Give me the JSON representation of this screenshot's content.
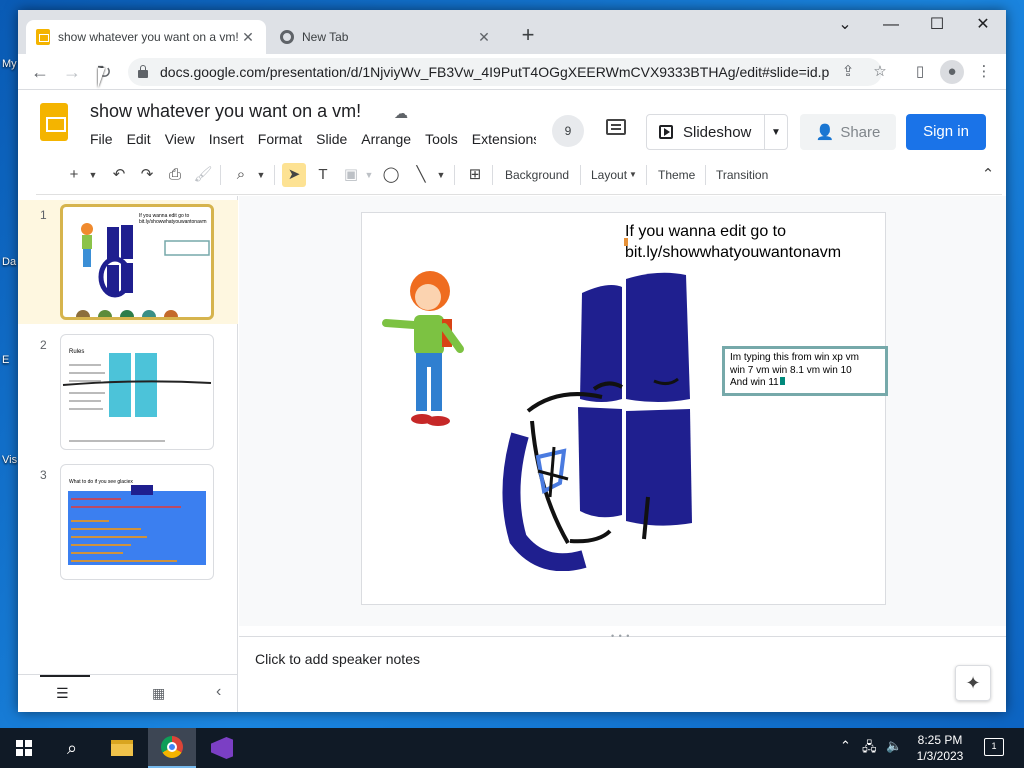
{
  "desktop": {
    "icon_labels": [
      "My",
      "Da",
      "E",
      "Vis"
    ]
  },
  "browser": {
    "tabs": [
      {
        "title": "show whatever you want on a vm!"
      },
      {
        "title": "New Tab"
      }
    ],
    "url": "docs.google.com/presentation/d/1NjviyWv_FB3Vw_4I9PutT4OGgXEERWmCVX9333BTHAg/edit#slide=id.p"
  },
  "app": {
    "doc_title": "show whatever you want on a vm!",
    "menu": [
      "File",
      "Edit",
      "View",
      "Insert",
      "Format",
      "Slide",
      "Arrange",
      "Tools",
      "Extensions"
    ],
    "user_count": "9",
    "slideshow_label": "Slideshow",
    "share_label": "Share",
    "signin_label": "Sign in",
    "toolbar": {
      "background": "Background",
      "layout": "Layout",
      "theme": "Theme",
      "transition": "Transition"
    },
    "slide_numbers": [
      "1",
      "2",
      "3"
    ],
    "thumbs": {
      "t1_title": "If you wanna edit go to bit.ly/showwhatyouwantonavm",
      "t2_title": "Rules",
      "t3_title": "What to do if you see glaciex"
    },
    "slide": {
      "title_line1": "If you wanna edit go to",
      "title_line2": "bit.ly/showwhatyouwantonavm",
      "textbox_line1": "Im typing this from win xp vm",
      "textbox_line2": "win 7 vm win 8.1 vm win 10",
      "textbox_line3": "And win 11"
    },
    "notes_placeholder": "Click to add speaker notes"
  },
  "taskbar": {
    "time": "8:25 PM",
    "date": "1/3/2023",
    "notifications": "1"
  },
  "colors": {
    "accent_blue": "#1a73e8",
    "slides_yellow": "#f4b400",
    "drawing_navy": "#1f1f8f",
    "textbox_border": "#76a9aa"
  }
}
